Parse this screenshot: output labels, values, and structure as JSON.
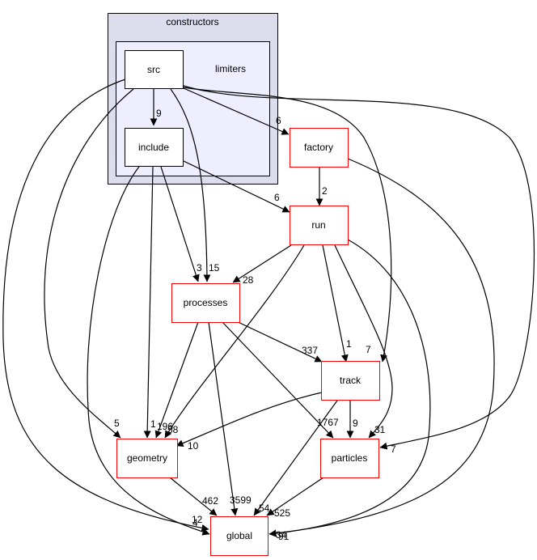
{
  "clusters": {
    "outer": {
      "label": "constructors"
    },
    "inner": {
      "label": "limiters"
    }
  },
  "colors": {
    "outer_fill": "#ddddee",
    "inner_fill": "#eeeeff",
    "cluster_stroke": "#000000",
    "external_stroke": "#ff0000",
    "internal_stroke": "#000000"
  },
  "nodes": [
    {
      "id": "src",
      "label": "src",
      "type": "internal"
    },
    {
      "id": "include",
      "label": "include",
      "type": "internal"
    },
    {
      "id": "factory",
      "label": "factory",
      "type": "external"
    },
    {
      "id": "run",
      "label": "run",
      "type": "external"
    },
    {
      "id": "processes",
      "label": "processes",
      "type": "external"
    },
    {
      "id": "track",
      "label": "track",
      "type": "external"
    },
    {
      "id": "geometry",
      "label": "geometry",
      "type": "external"
    },
    {
      "id": "particles",
      "label": "particles",
      "type": "external"
    },
    {
      "id": "global",
      "label": "global",
      "type": "external"
    }
  ],
  "edges": [
    {
      "from": "src",
      "to": "include",
      "label": "9"
    },
    {
      "from": "src",
      "to": "factory",
      "label": "6"
    },
    {
      "from": "src",
      "to": "processes",
      "label": "15"
    },
    {
      "from": "src",
      "to": "track",
      "label": "7"
    },
    {
      "from": "src",
      "to": "particles",
      "label": "7"
    },
    {
      "from": "src",
      "to": "geometry",
      "label": "5"
    },
    {
      "from": "src",
      "to": "global",
      "label": "12"
    },
    {
      "from": "include",
      "to": "run",
      "label": "6"
    },
    {
      "from": "include",
      "to": "processes",
      "label": "3"
    },
    {
      "from": "include",
      "to": "geometry",
      "label": "1"
    },
    {
      "from": "include",
      "to": "global",
      "label": "4"
    },
    {
      "from": "factory",
      "to": "run",
      "label": "2"
    },
    {
      "from": "factory",
      "to": "global",
      "label": "34"
    },
    {
      "from": "run",
      "to": "processes",
      "label": "28"
    },
    {
      "from": "run",
      "to": "track",
      "label": "1"
    },
    {
      "from": "run",
      "to": "geometry",
      "label": "58"
    },
    {
      "from": "run",
      "to": "particles",
      "label": "31"
    },
    {
      "from": "run",
      "to": "global",
      "label": "91"
    },
    {
      "from": "processes",
      "to": "track",
      "label": "337"
    },
    {
      "from": "processes",
      "to": "geometry",
      "label": "196"
    },
    {
      "from": "processes",
      "to": "particles",
      "label": "1767"
    },
    {
      "from": "processes",
      "to": "global",
      "label": "3599"
    },
    {
      "from": "track",
      "to": "geometry",
      "label": "10"
    },
    {
      "from": "track",
      "to": "particles",
      "label": "9"
    },
    {
      "from": "track",
      "to": "global",
      "label": "54"
    },
    {
      "from": "geometry",
      "to": "global",
      "label": "462"
    },
    {
      "from": "particles",
      "to": "global",
      "label": "525"
    }
  ]
}
